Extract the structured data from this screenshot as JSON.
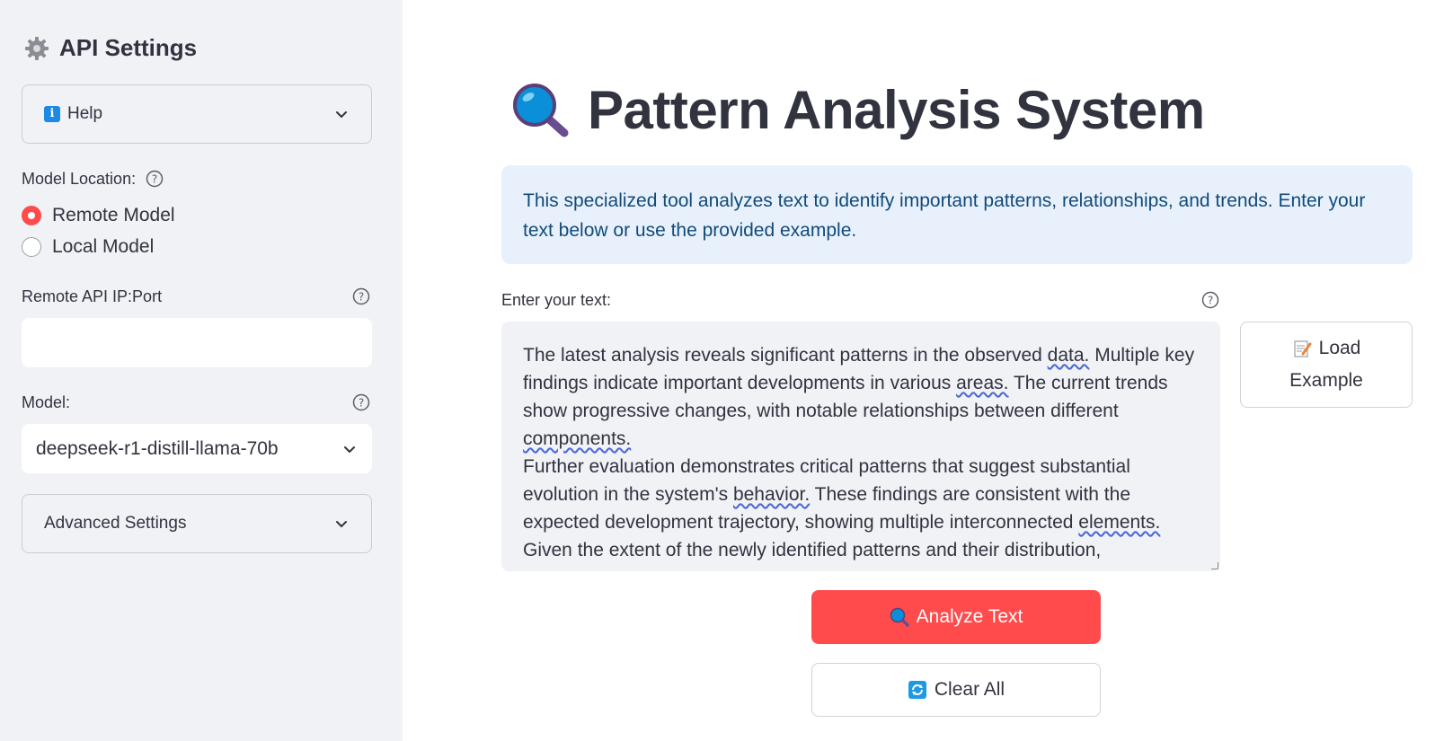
{
  "sidebar": {
    "title": "API Settings",
    "title_icon": "gear-icon",
    "help_label": "Help",
    "model_location_label": "Model Location:",
    "radio_options": [
      "Remote Model",
      "Local Model"
    ],
    "radio_selected": "Remote Model",
    "remote_api_label": "Remote API IP:Port",
    "remote_api_value": "",
    "model_label": "Model:",
    "model_value": "deepseek-r1-distill-llama-70b",
    "advanced_label": "Advanced Settings"
  },
  "main": {
    "title": "Pattern Analysis System",
    "title_icon": "magnifier-icon",
    "info_text": "This specialized tool analyzes text to identify important patterns, relationships, and trends. Enter your text below or use the provided example.",
    "textarea_label": "Enter your text:",
    "textarea_lines": {
      "p1_a": "The latest analysis reveals significant patterns in the observed ",
      "p1_w1": "data.",
      "p1_b": " Multiple key findings indicate important developments in various ",
      "p1_w2": "areas.",
      "p1_c": " The current trends show progressive changes, with notable relationships between different ",
      "p1_w3": "components.",
      "p2_a": "Further evaluation demonstrates critical patterns that suggest substantial evolution in the system's ",
      "p2_w1": "behavior.",
      "p2_b": " These findings are consistent with the expected development trajectory, showing multiple interconnected ",
      "p2_w2": "elements.",
      "p3": "Given the extent of the newly identified patterns and their distribution,"
    },
    "load_line1": "Load",
    "load_line2": "Example",
    "analyze_label": "Analyze Text",
    "clear_label": "Clear All"
  },
  "colors": {
    "sidebar_bg": "#f0f2f6",
    "accent": "#ff4b4b",
    "info_bg": "#e8f1fb",
    "info_text": "#114a7a",
    "text": "#31333f"
  }
}
